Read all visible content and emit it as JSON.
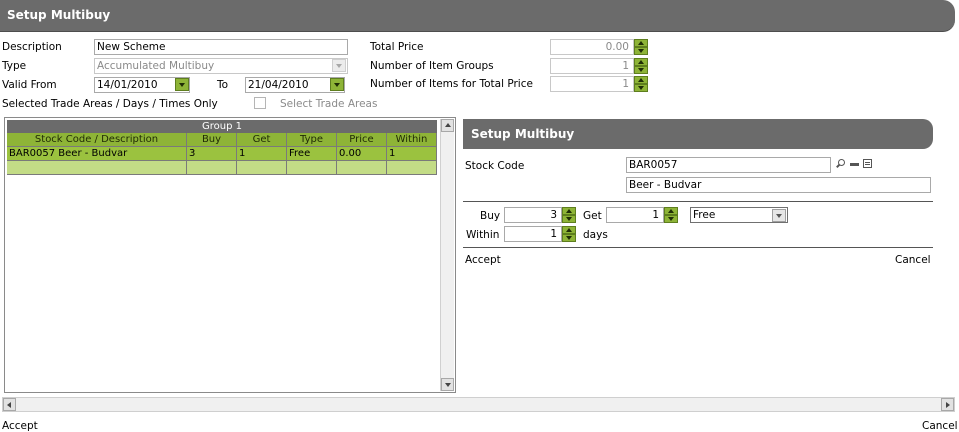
{
  "header": {
    "title": "Setup Multibuy"
  },
  "form": {
    "description_label": "Description",
    "description_value": "New Scheme",
    "type_label": "Type",
    "type_value": "Accumulated Multibuy",
    "valid_from_label": "Valid From",
    "valid_from_value": "14/01/2010",
    "to_label": "To",
    "to_value": "21/04/2010",
    "trade_areas_label": "Selected Trade Areas / Days / Times Only",
    "select_trade_areas_label": "Select Trade Areas",
    "total_price_label": "Total Price",
    "total_price_value": "0.00",
    "item_groups_label": "Number of Item Groups",
    "item_groups_value": "1",
    "items_total_label": "Number of Items for Total Price",
    "items_total_value": "1"
  },
  "grid": {
    "group_title": "Group 1",
    "columns": [
      "Stock Code / Description",
      "Buy",
      "Get",
      "Type",
      "Price",
      "Within"
    ],
    "rows": [
      [
        "BAR0057 Beer - Budvar",
        "3",
        "1",
        "Free",
        "0.00",
        "1"
      ]
    ]
  },
  "subpanel": {
    "title": "Setup Multibuy",
    "stock_code_label": "Stock Code",
    "stock_code_value": "BAR0057",
    "stock_desc_value": "Beer - Budvar",
    "buy_label": "Buy",
    "buy_value": "3",
    "get_label": "Get",
    "get_value": "1",
    "type_value": "Free",
    "within_label": "Within",
    "within_value": "1",
    "days_label": "days",
    "accept_label": "Accept",
    "cancel_label": "Cancel"
  },
  "footer": {
    "accept_label": "Accept",
    "cancel_label": "Cancel"
  },
  "colors": {
    "accent_green": "#8eb437",
    "header_gray": "#6b6b6b"
  }
}
